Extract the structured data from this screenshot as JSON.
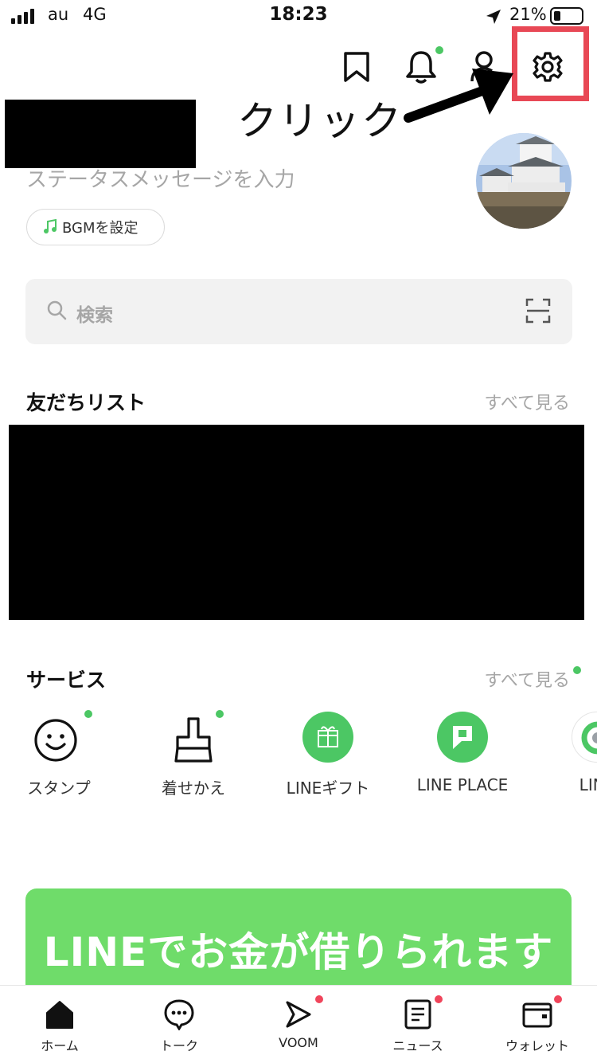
{
  "status_bar": {
    "carrier": "au",
    "network": "4G",
    "time": "18:23",
    "battery": "21%"
  },
  "annotation": {
    "click_label": "クリック",
    "highlight_color": "#e84855"
  },
  "profile": {
    "status_message_placeholder": "ステータスメッセージを入力",
    "bgm_label": "BGMを設定"
  },
  "search": {
    "placeholder": "検索"
  },
  "friends": {
    "title": "友だちリスト",
    "see_all": "すべて見る"
  },
  "services": {
    "title": "サービス",
    "see_all": "すべて見る",
    "items": [
      {
        "label": "スタンプ",
        "icon": "smiley-icon"
      },
      {
        "label": "着せかえ",
        "icon": "brush-icon"
      },
      {
        "label": "LINEギフト",
        "icon": "gift-icon"
      },
      {
        "label": "LINE PLACE",
        "icon": "place-icon"
      },
      {
        "label": "LINE",
        "icon": "partial-service-icon"
      }
    ]
  },
  "banner": {
    "text": "LINEでお金が借りられます"
  },
  "tabs": [
    {
      "label": "ホーム",
      "icon": "home-icon"
    },
    {
      "label": "トーク",
      "icon": "chat-icon"
    },
    {
      "label": "VOOM",
      "icon": "voom-icon"
    },
    {
      "label": "ニュース",
      "icon": "news-icon"
    },
    {
      "label": "ウォレット",
      "icon": "wallet-icon"
    }
  ],
  "colors": {
    "accent_green": "#4cc764",
    "badge_red": "#f0455b",
    "banner_green": "#6fdc6a"
  }
}
